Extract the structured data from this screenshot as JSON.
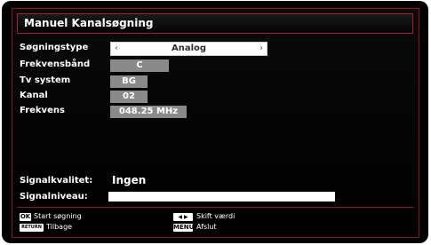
{
  "title": "Manuel Kanalsøgning",
  "fields": {
    "search_type": {
      "label": "Søgningstype",
      "value": "Analog",
      "left_arrow": "‹",
      "right_arrow": "›"
    },
    "band": {
      "label": "Frekvensbånd",
      "value": "C"
    },
    "tv_system": {
      "label": "Tv system",
      "value": "BG"
    },
    "channel": {
      "label": "Kanal",
      "value": "02"
    },
    "frequency": {
      "label": "Frekvens",
      "value": "048.25 MHz"
    }
  },
  "signal": {
    "quality_label": "Signalkvalitet:",
    "quality_value": "Ingen",
    "level_label": "Signalniveau:"
  },
  "footer": {
    "ok_key": "OK",
    "ok_text": "Start søgning",
    "return_key": "RETURN",
    "return_text": "Tilbage",
    "arrows_key": "◀ ▶",
    "arrows_text": "Skift værdi",
    "menu_key": "MENU",
    "menu_text": "Afslut"
  },
  "colors": {
    "frame": "#8c1424",
    "value_box": "#8a8a8a",
    "background": "#000000"
  }
}
